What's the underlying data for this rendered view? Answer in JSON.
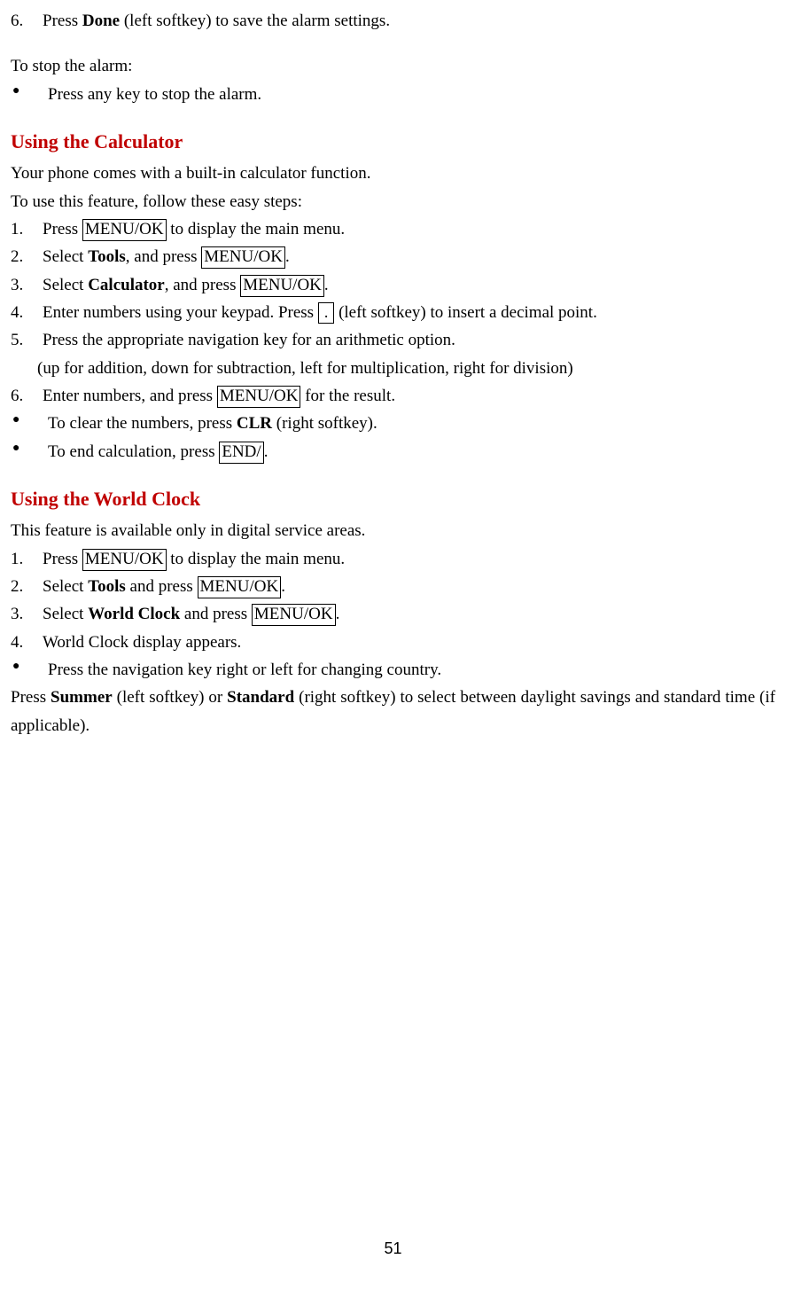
{
  "alarm": {
    "item6_marker": "6.",
    "item6_pre": "Press ",
    "item6_bold": "Done",
    "item6_post": " (left softkey) to save the alarm settings.",
    "stop_intro": "To stop the alarm:",
    "stop_bullet": "Press any key to stop the alarm."
  },
  "calc": {
    "heading": "Using the Calculator",
    "intro1": "Your phone comes with a built-in calculator function.",
    "intro2": "To use this feature, follow these easy steps:",
    "s1_marker": "1.",
    "s1_a": "Press ",
    "s1_box": "MENU/OK",
    "s1_b": " to display the main menu.",
    "s2_marker": "2.",
    "s2_a": "Select ",
    "s2_bold": "Tools",
    "s2_b": ", and press ",
    "s2_box": "MENU/OK",
    "s2_c": ".",
    "s3_marker": "3.",
    "s3_a": "Select ",
    "s3_bold": "Calculator",
    "s3_b": ", and press ",
    "s3_box": "MENU/OK",
    "s3_c": ".",
    "s4_marker": "4.",
    "s4_a": "Enter numbers using your keypad. Press ",
    "s4_box": " . ",
    "s4_b": " (left softkey) to insert a decimal point.",
    "s5_marker": "5.",
    "s5_a": "Press the appropriate navigation key for an arithmetic option.",
    "s5_sub": "(up for addition, down for subtraction, left for multiplication, right for division)",
    "s6_marker": "6.",
    "s6_a": "Enter numbers, and press ",
    "s6_box": "MENU/OK",
    "s6_b": " for the result.",
    "b1_a": "To clear the numbers, press ",
    "b1_bold": "CLR",
    "b1_b": " (right softkey).",
    "b2_a": "To end calculation, press ",
    "b2_box": "END/",
    "b2_b": "."
  },
  "clock": {
    "heading": "Using the World Clock",
    "intro": "This feature is available only in digital service areas.",
    "s1_marker": "1.",
    "s1_a": "Press ",
    "s1_box": "MENU/OK",
    "s1_b": " to display the main menu.",
    "s2_marker": "2.",
    "s2_a": "Select ",
    "s2_bold": "Tools",
    "s2_b": " and press ",
    "s2_box": "MENU/OK",
    "s2_c": ".",
    "s3_marker": "3.",
    "s3_a": "Select ",
    "s3_bold": "World Clock",
    "s3_b": " and press ",
    "s3_box": "MENU/OK",
    "s3_c": ".",
    "s4_marker": "4.",
    "s4_a": "World Clock display appears.",
    "b1": "Press the navigation key right or left for changing country.",
    "last_a": "Press ",
    "last_bold1": "Summer",
    "last_b": " (left softkey) or ",
    "last_bold2": "Standard",
    "last_c": " (right softkey) to select between daylight savings and standard time (if applicable)."
  },
  "page_number": "51",
  "bullet": "●"
}
